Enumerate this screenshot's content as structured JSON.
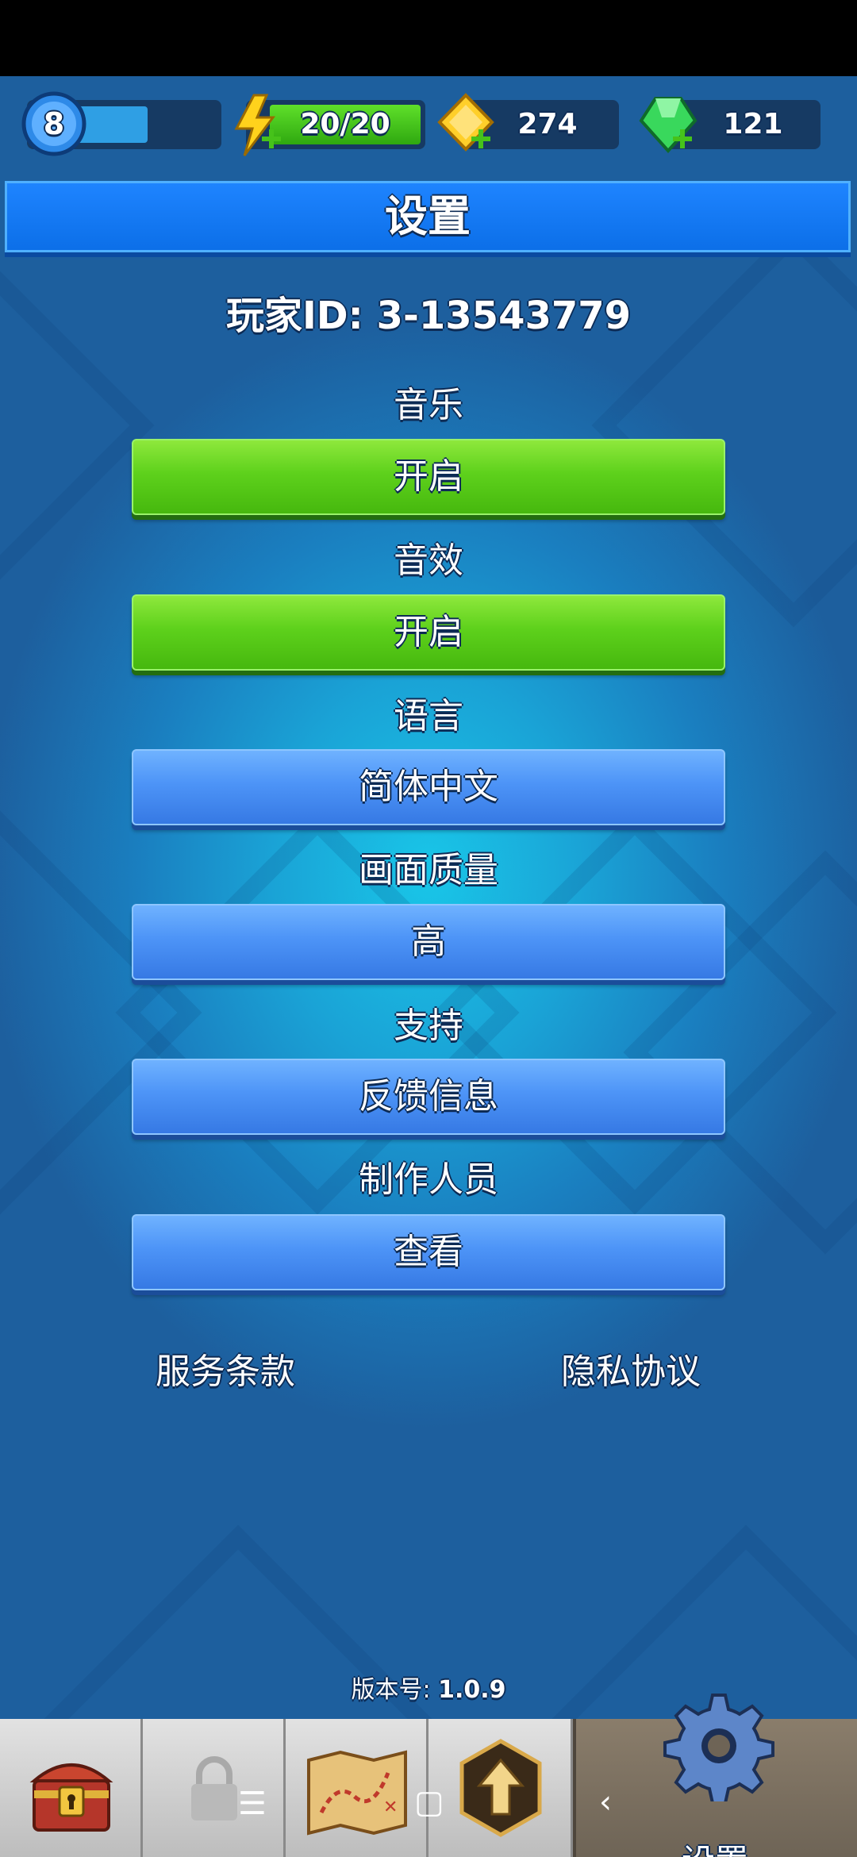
{
  "hud": {
    "level": "8",
    "level_progress": 0.55,
    "energy": "20/20",
    "energy_fill": 1.0,
    "gold": "274",
    "gems": "121"
  },
  "header": {
    "title": "设置"
  },
  "player": {
    "id_label": "玩家ID: 3-13543779"
  },
  "settings": {
    "music": {
      "label": "音乐",
      "value": "开启"
    },
    "sfx": {
      "label": "音效",
      "value": "开启"
    },
    "language": {
      "label": "语言",
      "value": "简体中文"
    },
    "quality": {
      "label": "画面质量",
      "value": "高"
    },
    "support": {
      "label": "支持",
      "value": "反馈信息"
    },
    "credits": {
      "label": "制作人员",
      "value": "查看"
    }
  },
  "links": {
    "terms": "服务条款",
    "privacy": "隐私协议"
  },
  "version": {
    "label": "版本号:",
    "value": "1.0.9"
  },
  "nav": {
    "active_label": "设置"
  },
  "colors": {
    "green_button": "#5ed11c",
    "blue_button": "#4d94f7",
    "header_blue": "#1e84ff"
  }
}
